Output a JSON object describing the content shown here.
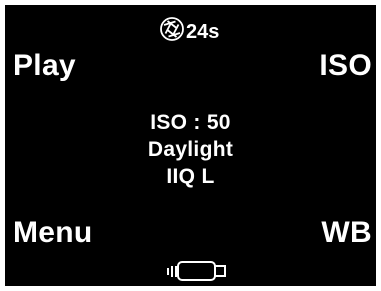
{
  "status": {
    "timer_icon": "shutter-timer-icon",
    "timer_text": "24s",
    "battery_icon": "battery-icon"
  },
  "softkeys": {
    "top_left": "Play",
    "top_right": "ISO",
    "bottom_left": "Menu",
    "bottom_right": "WB"
  },
  "info": {
    "iso": "ISO : 50",
    "white_balance": "Daylight",
    "file_format": "IIQ L"
  },
  "colors": {
    "screen_background": "#000000",
    "text": "#ffffff",
    "frame": "#ffffff"
  }
}
